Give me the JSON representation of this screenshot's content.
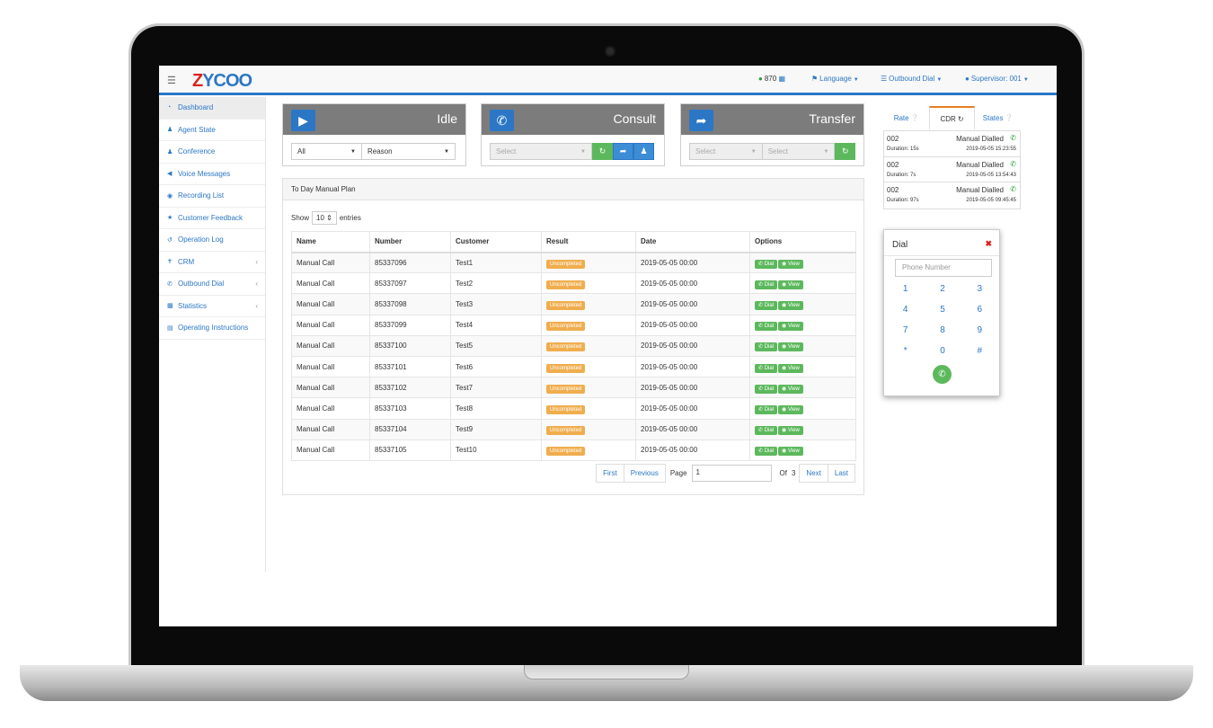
{
  "header": {
    "logo_z": "Z",
    "logo_rest": "YCOO",
    "queue_count": "870",
    "language": "Language",
    "outbound_dial": "Outbound Dial",
    "supervisor": "Supervisor: 001"
  },
  "sidebar": {
    "items": [
      {
        "label": "Dashboard",
        "icon": "dashboard-icon"
      },
      {
        "label": "Agent State",
        "icon": "user-icon"
      },
      {
        "label": "Conference",
        "icon": "users-icon"
      },
      {
        "label": "Voice Messages",
        "icon": "volume-icon"
      },
      {
        "label": "Recording List",
        "icon": "record-icon"
      },
      {
        "label": "Customer Feedback",
        "icon": "star-icon"
      },
      {
        "label": "Operation Log",
        "icon": "history-icon"
      },
      {
        "label": "CRM",
        "icon": "person-icon"
      },
      {
        "label": "Outbound Dial",
        "icon": "phone-icon"
      },
      {
        "label": "Statistics",
        "icon": "bar-chart-icon"
      },
      {
        "label": "Operating Instructions",
        "icon": "book-icon"
      }
    ]
  },
  "status": {
    "idle": {
      "title": "Idle",
      "select1": "All",
      "select2": "Reason"
    },
    "consult": {
      "title": "Consult",
      "select1": "Select"
    },
    "transfer": {
      "title": "Transfer",
      "select1": "Select",
      "select2": "Select"
    }
  },
  "table": {
    "title": "To Day Manual Plan",
    "show_label": "Show",
    "entries_count": "10",
    "entries_label": "entries",
    "columns": [
      "Name",
      "Number",
      "Customer",
      "Result",
      "Date",
      "Options"
    ],
    "dial_label": "Dial",
    "view_label": "View",
    "rows": [
      {
        "name": "Manual Call",
        "number": "85337096",
        "customer": "Test1",
        "result": "Uncompleted",
        "date": "2019-05-05 00:00"
      },
      {
        "name": "Manual Call",
        "number": "85337097",
        "customer": "Test2",
        "result": "Uncompleted",
        "date": "2019-05-05 00:00"
      },
      {
        "name": "Manual Call",
        "number": "85337098",
        "customer": "Test3",
        "result": "Uncompleted",
        "date": "2019-05-05 00:00"
      },
      {
        "name": "Manual Call",
        "number": "85337099",
        "customer": "Test4",
        "result": "Uncompleted",
        "date": "2019-05-05 00:00"
      },
      {
        "name": "Manual Call",
        "number": "85337100",
        "customer": "Test5",
        "result": "Uncompleted",
        "date": "2019-05-05 00:00"
      },
      {
        "name": "Manual Call",
        "number": "85337101",
        "customer": "Test6",
        "result": "Uncompleted",
        "date": "2019-05-05 00:00"
      },
      {
        "name": "Manual Call",
        "number": "85337102",
        "customer": "Test7",
        "result": "Uncompleted",
        "date": "2019-05-05 00:00"
      },
      {
        "name": "Manual Call",
        "number": "85337103",
        "customer": "Test8",
        "result": "Uncompleted",
        "date": "2019-05-05 00:00"
      },
      {
        "name": "Manual Call",
        "number": "85337104",
        "customer": "Test9",
        "result": "Uncompleted",
        "date": "2019-05-05 00:00"
      },
      {
        "name": "Manual Call",
        "number": "85337105",
        "customer": "Test10",
        "result": "Uncompleted",
        "date": "2019-05-05 00:00"
      }
    ]
  },
  "pager": {
    "first": "First",
    "previous": "Previous",
    "page_label": "Page",
    "page_value": "1",
    "of_label": "Of",
    "total_pages": "3",
    "next": "Next",
    "last": "Last"
  },
  "cdr_tabs": {
    "rate": "Rate",
    "cdr": "CDR",
    "states": "States"
  },
  "cdr": [
    {
      "number": "002",
      "duration": "Duration: 15s",
      "type": "Manual Dialled",
      "date": "2019-05-05 15:23:55"
    },
    {
      "number": "002",
      "duration": "Duration: 7s",
      "type": "Manual Dialled",
      "date": "2019-05-05 13:54:43"
    },
    {
      "number": "002",
      "duration": "Duration: 97s",
      "type": "Manual Dialled",
      "date": "2019-05-05 09:45:45"
    }
  ],
  "dial": {
    "title": "Dial",
    "placeholder": "Phone Number",
    "keys": [
      "1",
      "2",
      "3",
      "4",
      "5",
      "6",
      "7",
      "8",
      "9",
      "*",
      "0",
      "#"
    ]
  },
  "colors": {
    "accent": "#2b77c5",
    "success": "#5cb85c",
    "warning": "#f0ad4e",
    "danger": "#d9221c"
  }
}
